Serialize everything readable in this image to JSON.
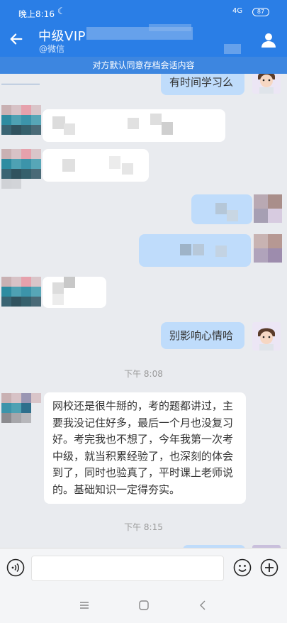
{
  "status": {
    "time": "晚上8:16",
    "net": "4G",
    "battery": "87",
    "moon_icon": "moon-icon"
  },
  "header": {
    "title": "中级VIP",
    "subtitle": "@微信",
    "back_icon": "back-arrow-icon",
    "person_icon": "person-icon"
  },
  "notice": "对方默认同意存档会话内容",
  "messages": [
    {
      "side": "right",
      "text": "有时间学习么"
    },
    {
      "side": "left",
      "text": ""
    },
    {
      "side": "left",
      "text": ""
    },
    {
      "side": "right",
      "text": ""
    },
    {
      "side": "right",
      "text": ""
    },
    {
      "side": "left",
      "text": ""
    },
    {
      "side": "right",
      "text": "别影响心情哈"
    },
    {
      "side": "left",
      "text": "网校还是很牛掰的，考的题都讲过，主要我没记住好多，最后一个月也没复习好。考完我也不想了，今年我第一次考中级，就当积累经验了，也深刻的体会到了，同时也验真了，平时课上老师说的。基础知识一定得夯实。"
    }
  ],
  "timestamps": [
    "下午 8:08",
    "下午 8:15"
  ],
  "inputbar": {
    "voice_icon": "voice-icon",
    "emoji_icon": "emoji-icon",
    "plus_icon": "plus-icon",
    "input_value": ""
  },
  "navbar": {
    "menu_icon": "menu-icon",
    "home_icon": "home-icon",
    "back_icon": "back-icon"
  },
  "colors": {
    "brand": "#2a7ee6",
    "my_bubble": "#bfdcfb",
    "bg": "#e9ebef"
  }
}
